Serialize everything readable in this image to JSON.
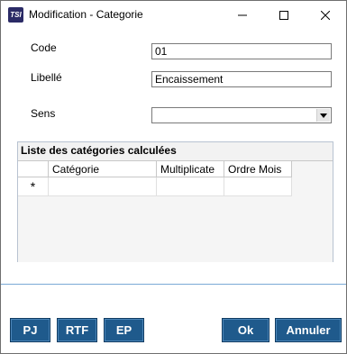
{
  "window": {
    "title": "Modification - Categorie",
    "app_icon_text": "TSI"
  },
  "form": {
    "code_label": "Code",
    "code_value": "01",
    "libelle_label": "Libellé",
    "libelle_value": "Encaissement",
    "sens_label": "Sens",
    "sens_value": ""
  },
  "group": {
    "title": "Liste des catégories calculées",
    "columns": [
      "",
      "Catégorie",
      "Multiplicate",
      "Ordre Mois"
    ],
    "new_row_marker": "*"
  },
  "buttons": {
    "pj": "PJ",
    "rtf": "RTF",
    "ep": "EP",
    "ok": "Ok",
    "annuler": "Annuler"
  },
  "colors": {
    "button_bg": "#1f5a8c",
    "separator": "#7aaad6",
    "group_border": "#b8c3d1"
  }
}
